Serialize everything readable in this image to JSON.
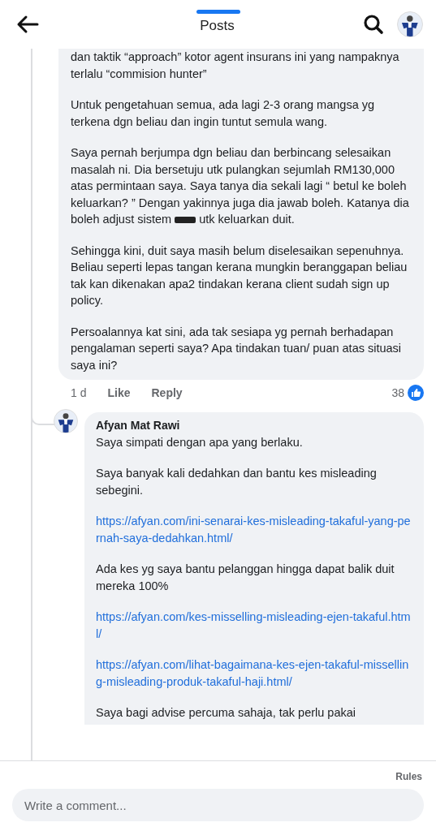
{
  "header": {
    "title": "Posts"
  },
  "comment": {
    "paragraphs": [
      {
        "kind": "text",
        "text": "dan taktik “approach” kotor agent insurans ini yang nampaknya terlalu “commision hunter”"
      },
      {
        "kind": "text",
        "text": "Untuk pengetahuan semua, ada lagi 2-3 orang mangsa yg terkena dgn beliau dan ingin tuntut semula wang."
      },
      {
        "kind": "redacted",
        "before": "Saya pernah berjumpa dgn beliau dan berbincang selesaikan masalah ni. Dia bersetuju utk pulangkan sejumlah RM130,000 atas permintaan saya. Saya tanya dia sekali lagi “ betul ke boleh keluarkan? ” Dengan yakinnya juga dia jawab boleh. Katanya dia boleh adjust sistem",
        "after": "utk keluarkan duit."
      },
      {
        "kind": "text",
        "text": "Sehingga kini, duit saya masih belum diselesaikan sepenuhnya. Beliau seperti lepas tangan kerana mungkin beranggapan beliau tak kan dikenakan apa2 tindakan kerana client sudah sign up policy."
      },
      {
        "kind": "text",
        "text": "Persoalannya kat sini, ada tak sesiapa yg pernah berhadapan pengalaman seperti saya? Apa tindakan tuan/ puan atas situasi saya ini?"
      }
    ],
    "time": "1 d",
    "actions": [
      "Like",
      "Reply"
    ],
    "reaction_count": "38"
  },
  "reply": {
    "author": "Afyan Mat Rawi",
    "paragraphs": [
      {
        "kind": "text",
        "text": "Saya simpati dengan apa yang berlaku."
      },
      {
        "kind": "text",
        "text": "Saya banyak kali dedahkan dan bantu kes misleading sebegini."
      },
      {
        "kind": "link",
        "text": "https://afyan.com/ini-senarai-kes-misleading-takaful-yang-pernah-saya-dedahkan.html/"
      },
      {
        "kind": "text",
        "text": "Ada kes yg saya bantu pelanggan hingga dapat balik duit mereka 100%"
      },
      {
        "kind": "link",
        "text": "https://afyan.com/kes-misselling-misleading-ejen-takaful.html/"
      },
      {
        "kind": "link",
        "text": "https://afyan.com/lihat-bagaimana-kes-ejen-takaful-misselling-misleading-produk-takaful-haji.html/"
      },
      {
        "kind": "text",
        "text": "Saya bagi advise percuma sahaja, tak perlu pakai"
      }
    ]
  },
  "footer": {
    "rules": "Rules",
    "placeholder": "Write a comment..."
  }
}
